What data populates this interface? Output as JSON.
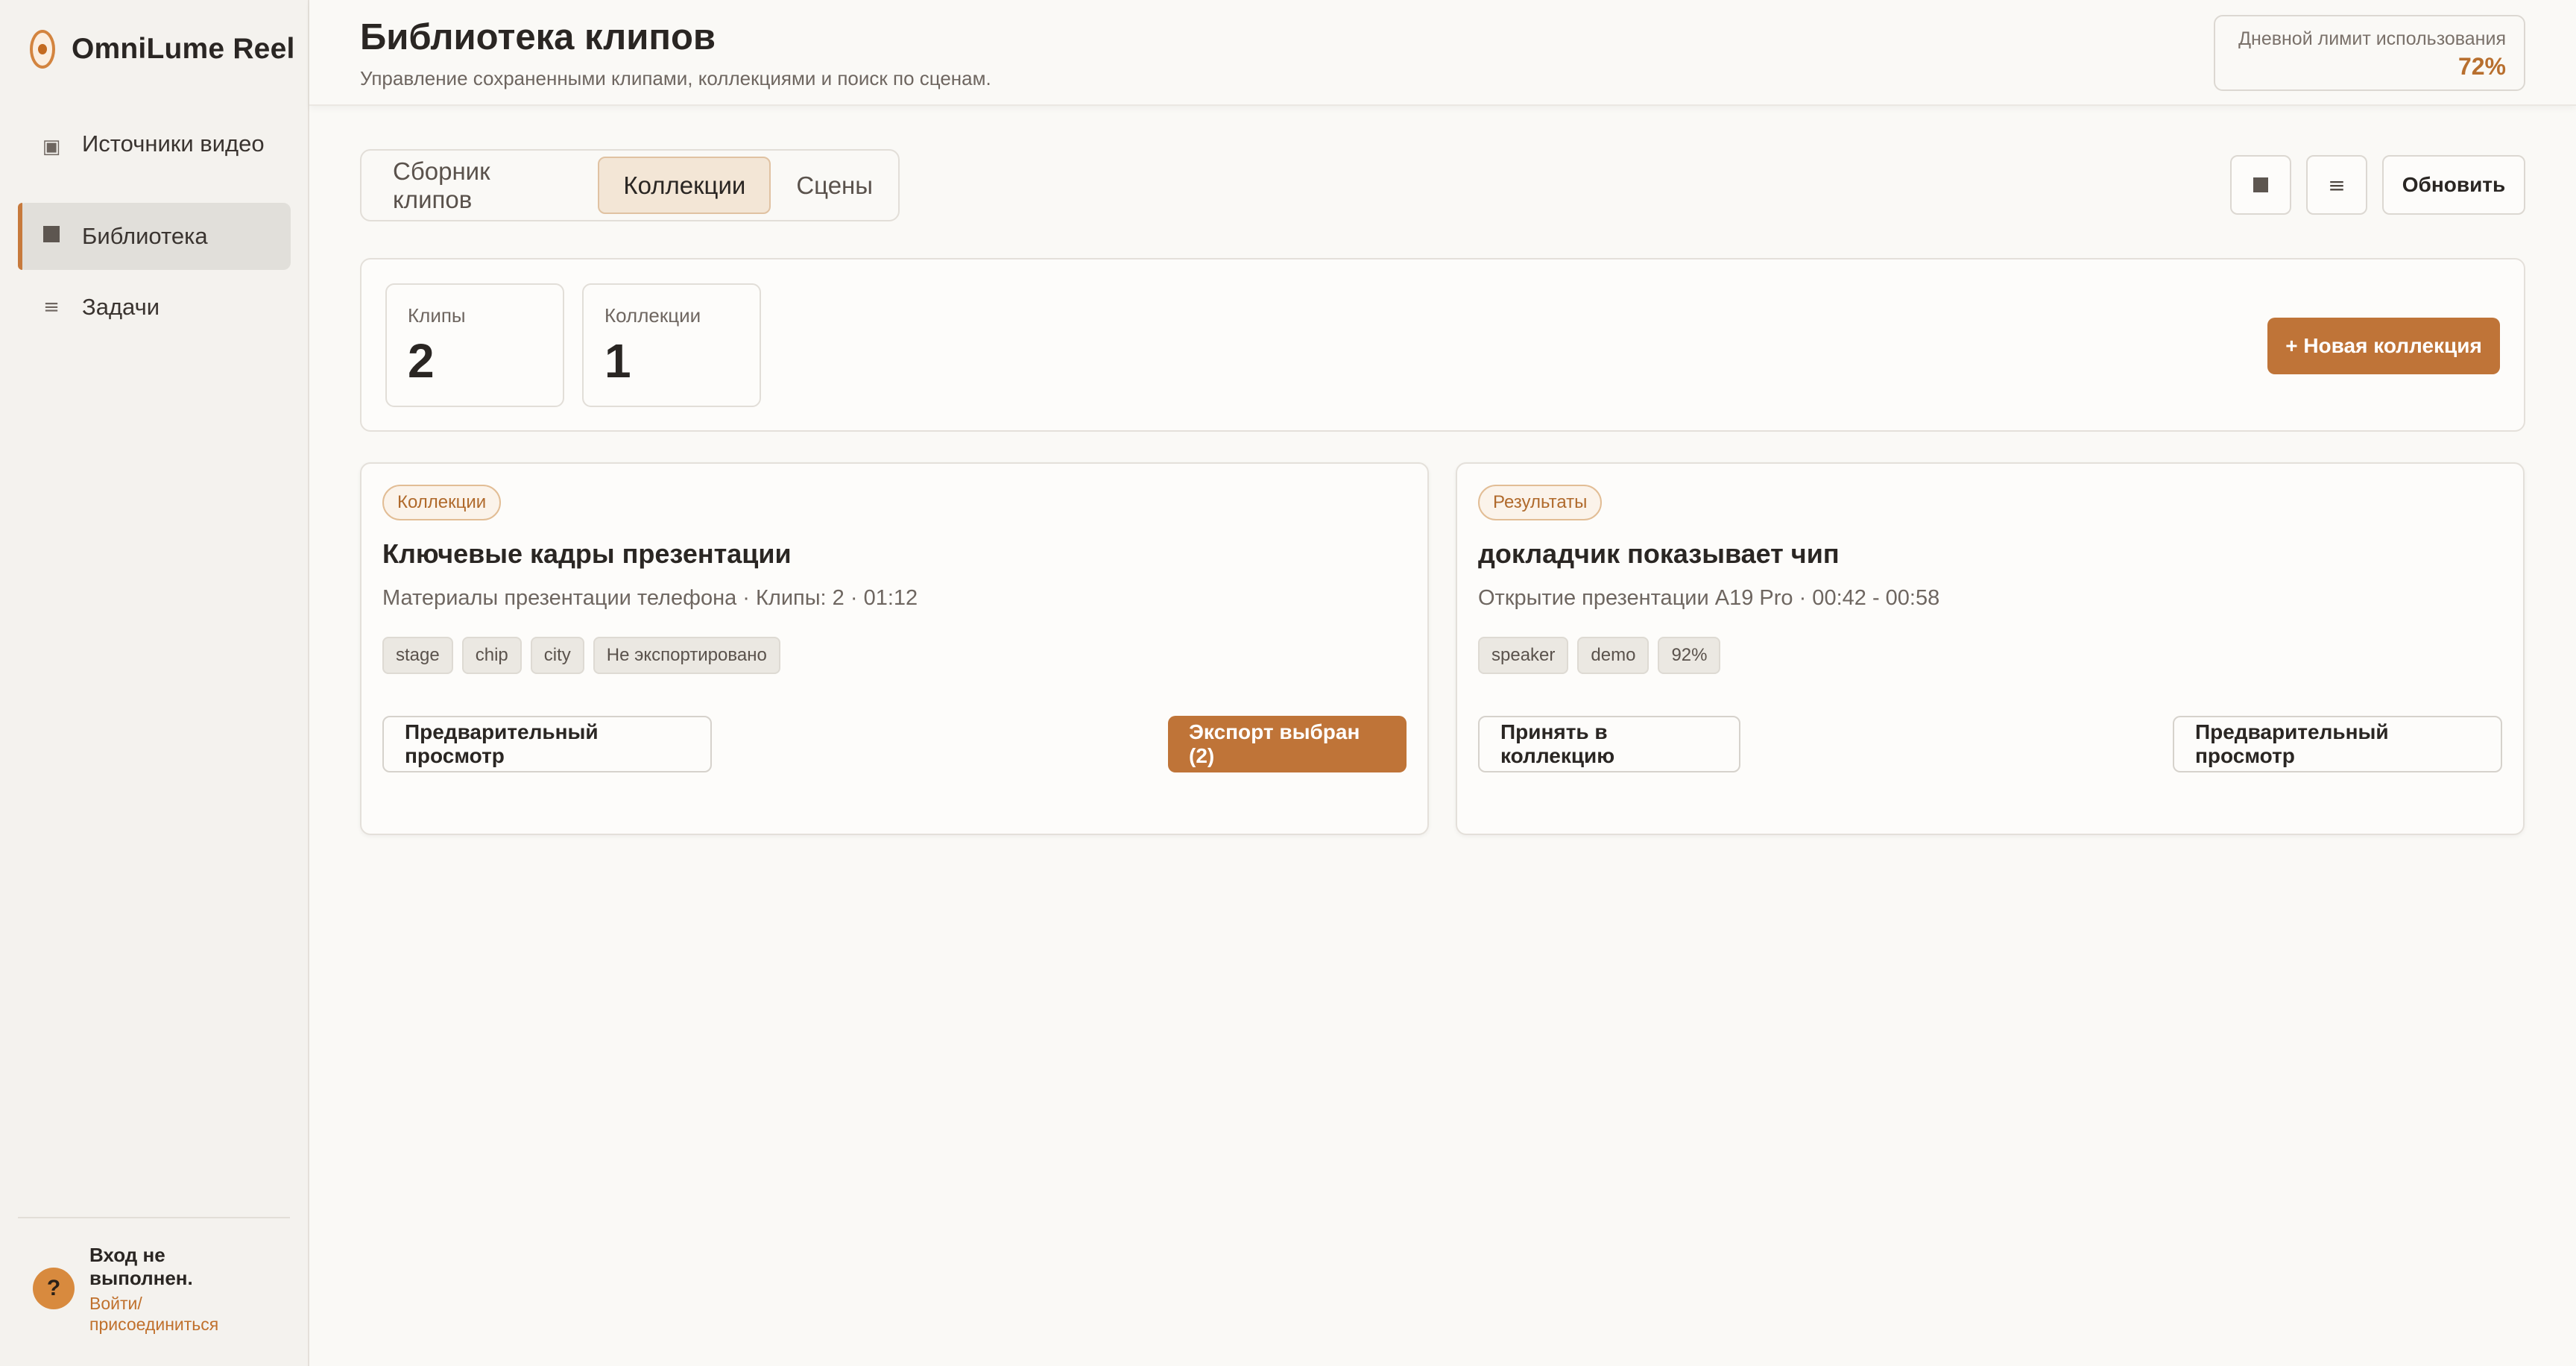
{
  "app": {
    "brand": "OmniLume Reel"
  },
  "sidebar": {
    "items": [
      {
        "label": "Источники видео",
        "icon": "video-source-icon"
      },
      {
        "label": "Библиотека",
        "icon": "library-icon",
        "active": true
      },
      {
        "label": "Задачи",
        "icon": "tasks-icon"
      }
    ],
    "user": {
      "avatar": "?",
      "status": "Вход не выполнен.",
      "link": "Войти/присоединиться"
    }
  },
  "header": {
    "title": "Библиотека клипов",
    "subtitle": "Управление сохраненными клипами, коллекциями и поиск по сценам.",
    "quota_label": "Дневной лимит использования",
    "quota_value": "72%"
  },
  "tabs": [
    {
      "label": "Сборник клипов",
      "active": false
    },
    {
      "label": "Коллекции",
      "active": true
    },
    {
      "label": "Сцены",
      "active": false
    }
  ],
  "toolbar": {
    "grid_icon": "grid-view-icon",
    "list_icon": "list-view-icon",
    "refresh_label": "Обновить"
  },
  "stats": {
    "clips_label": "Клипы",
    "clips_value": "2",
    "collections_label": "Коллекции",
    "collections_value": "1",
    "new_collection_label": "+ Новая коллекция"
  },
  "cards": [
    {
      "badge": "Коллекции",
      "title": "Ключевые кадры презентации",
      "meta": "Материалы презентации телефона · Клипы: 2 · 01:12",
      "chips": [
        "stage",
        "chip",
        "city",
        "Не экспортировано"
      ],
      "secondary_label": "Предварительный просмотр",
      "primary_label": "Экспорт выбран (2)"
    },
    {
      "badge": "Результаты",
      "title": "докладчик показывает чип",
      "meta": "Открытие презентации A19 Pro · 00:42 - 00:58",
      "chips": [
        "speaker",
        "demo",
        "92%"
      ],
      "accept_label": "Принять в коллекцию",
      "preview_label": "Предварительный просмотр"
    }
  ],
  "colors": {
    "accent": "#bf7438",
    "accent_text": "#b86f2e",
    "background": "#faf9f6",
    "sidebar": "#f4f2ee"
  }
}
